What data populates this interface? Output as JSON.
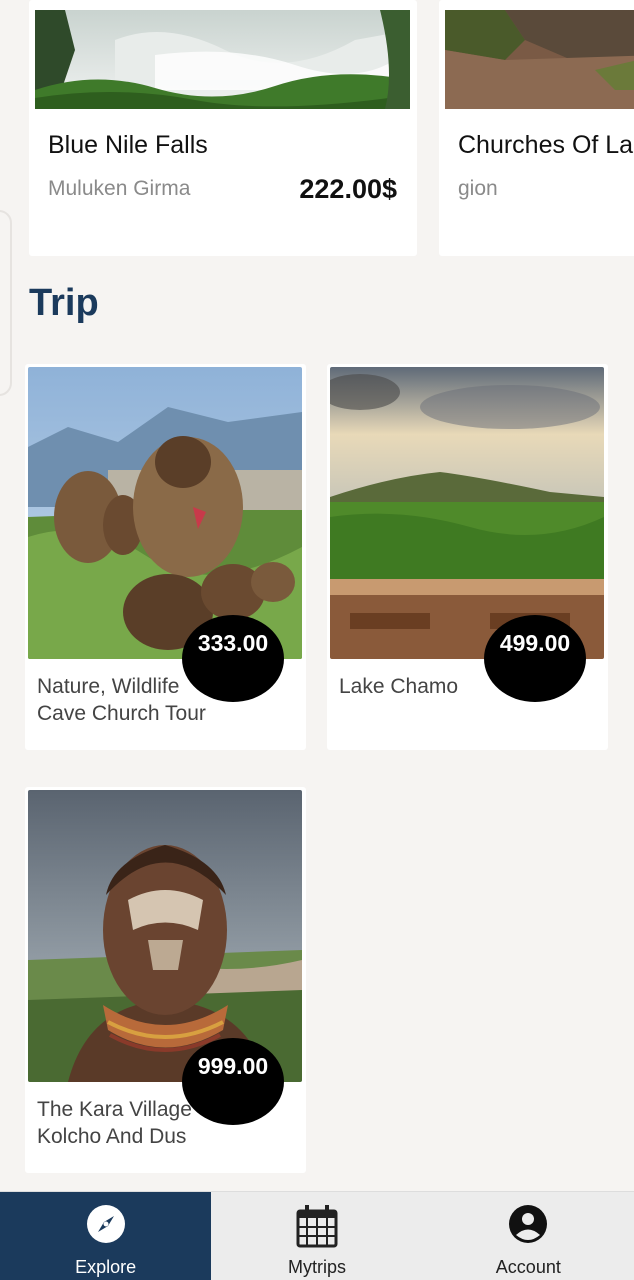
{
  "featured": [
    {
      "title": "Blue Nile Falls",
      "subtitle": "Muluken Girma",
      "price": "222.00$"
    },
    {
      "title": "Churches Of La",
      "subtitle": "gion",
      "price": ""
    }
  ],
  "section_title": "Trip",
  "trips": [
    {
      "name": "Nature, Wildlife Cave Church Tour",
      "price": "333.00"
    },
    {
      "name": "Lake Chamo",
      "price": "499.00"
    },
    {
      "name": "The Kara Village Kolcho And Dus",
      "price": "999.00"
    }
  ],
  "nav": {
    "explore": "Explore",
    "mytrips": "Mytrips",
    "account": "Account"
  },
  "colors": {
    "primary": "#1b3a5c",
    "background": "#f6f4f2",
    "badge": "#000000"
  },
  "icons": {
    "explore": "compass-icon",
    "mytrips": "calendar-icon",
    "account": "account-circle-icon"
  }
}
